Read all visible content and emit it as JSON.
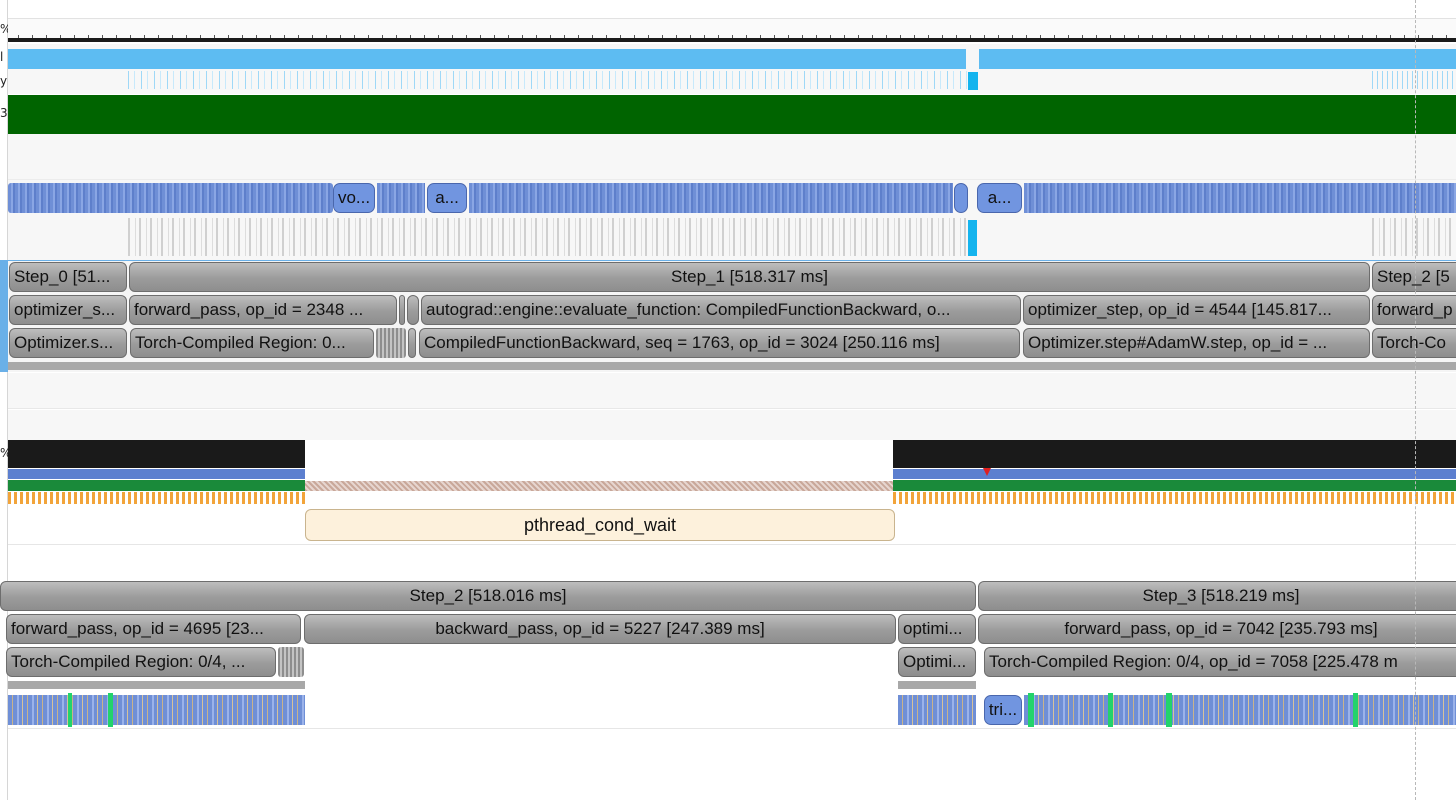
{
  "gutter_labels": {
    "ruler": "%",
    "blue_track": "l",
    "light_track": "y",
    "green_track": "3",
    "cpu_track": "%"
  },
  "pills_top": [
    {
      "label": "vo..."
    },
    {
      "label": "a..."
    },
    {
      "label": "a..."
    }
  ],
  "upper_group": {
    "row1": {
      "step_0": "Step_0 [51...",
      "step_1": "Step_1 [518.317 ms]",
      "step_2": "Step_2 [5"
    },
    "row2": {
      "optimizer": "optimizer_s...",
      "forward": "forward_pass, op_id = 2348 ...",
      "autograd": "autograd::engine::evaluate_function: CompiledFunctionBackward, o...",
      "optimizer_step": "optimizer_step, op_id = 4544 [145.817...",
      "forward_next": "forward_p"
    },
    "row3": {
      "optimizer": "Optimizer.s...",
      "torch_compiled": "Torch-Compiled Region: 0...",
      "compiled_backward": "CompiledFunctionBackward, seq = 1763, op_id = 3024 [250.116 ms]",
      "adamw": "Optimizer.step#AdamW.step, op_id = ...",
      "torch_next": "Torch-Co"
    }
  },
  "thread_state": {
    "wait_label": "pthread_cond_wait"
  },
  "lower_group": {
    "row1": {
      "step_2": "Step_2 [518.016 ms]",
      "step_3": "Step_3 [518.219 ms]"
    },
    "row2": {
      "forward": "forward_pass, op_id = 4695 [23...",
      "backward": "backward_pass, op_id = 5227 [247.389 ms]",
      "optimizer": "optimi...",
      "forward_next": "forward_pass, op_id = 7042 [235.793 ms]"
    },
    "row3": {
      "torch_compiled": "Torch-Compiled Region: 0/4, ...",
      "optimizer": "Optimi...",
      "torch_next": "Torch-Compiled Region: 0/4, op_id = 7058 [225.478 m"
    },
    "pill_label": "tri..."
  },
  "colors": {
    "blue_bar": "#5dbcf2",
    "green_track": "#006400",
    "slice_gray": "#a3a3a3",
    "pill_blue": "#7195e0",
    "wait_fill": "#fdf1dc"
  }
}
